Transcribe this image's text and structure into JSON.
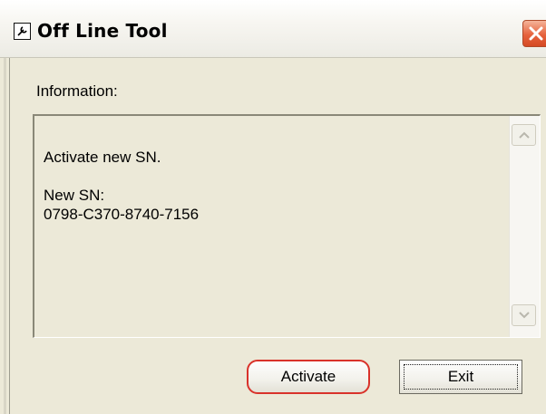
{
  "window": {
    "title": "Off Line Tool",
    "icon": "wrench-app-icon",
    "close_icon": "close-icon"
  },
  "info": {
    "label": "Information:",
    "lines": [
      "Activate new SN.",
      "",
      "New SN:",
      "0798-C370-8740-7156"
    ]
  },
  "buttons": {
    "activate_label": "Activate",
    "exit_label": "Exit"
  },
  "colors": {
    "dialog_background": "#ece9d8",
    "close_button": "#e6633e",
    "activate_highlight": "#d9322a"
  }
}
